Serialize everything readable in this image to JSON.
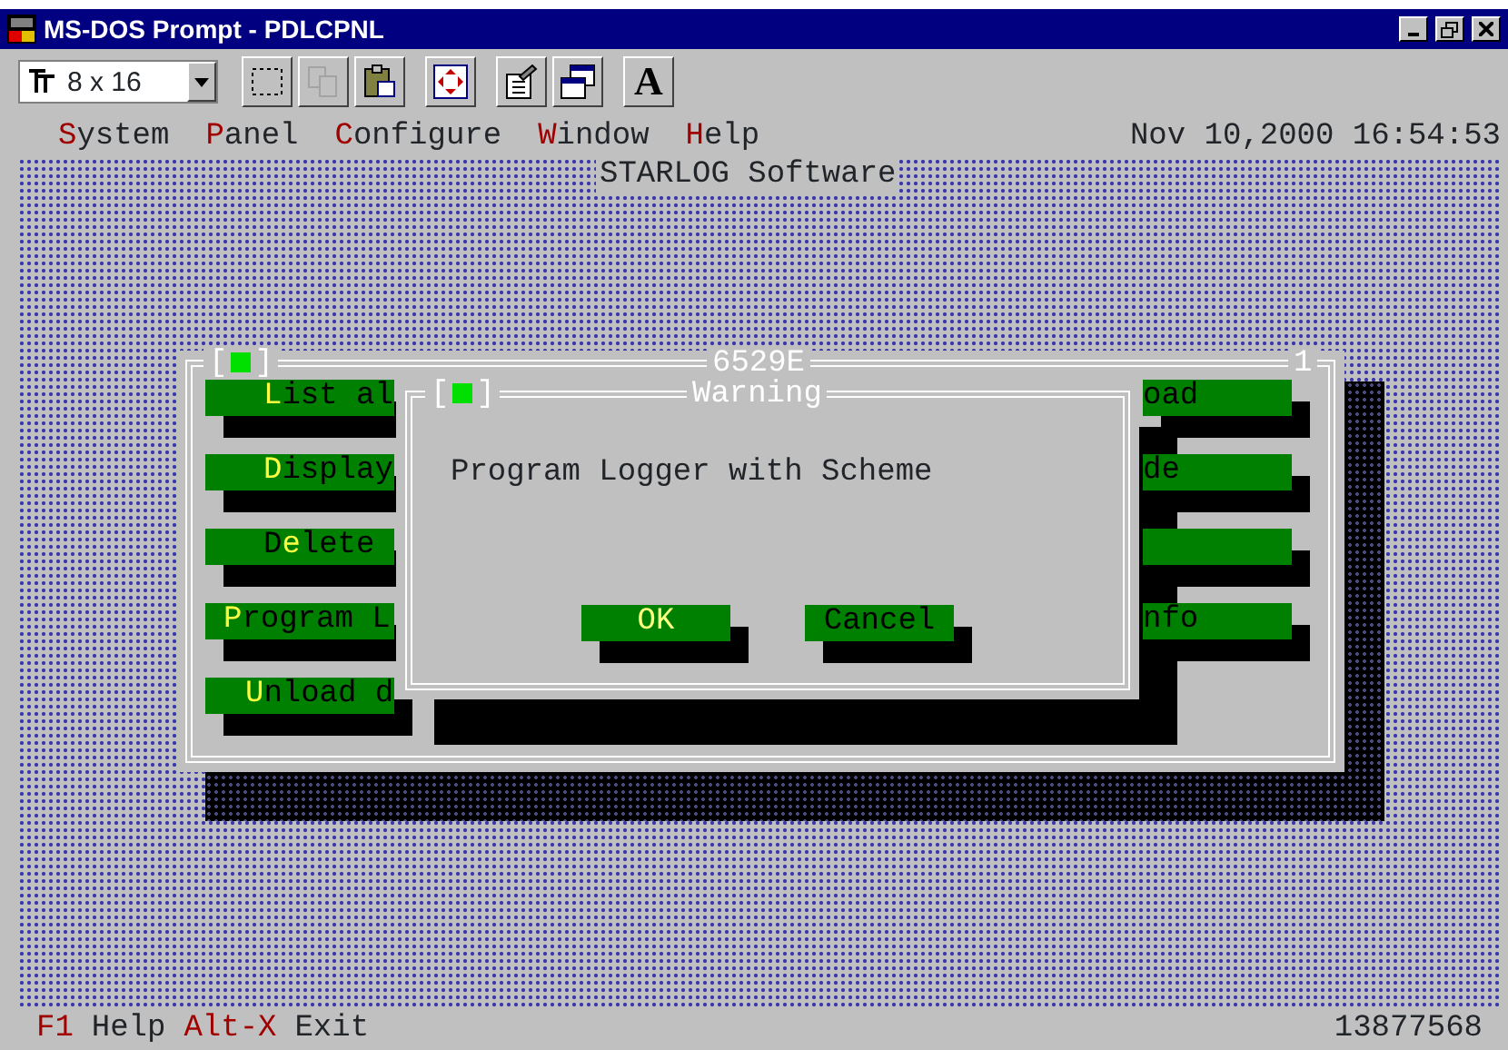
{
  "window": {
    "title": "MS-DOS Prompt - PDLCPNL"
  },
  "toolbar": {
    "font_size": "8 x 16",
    "buttons": [
      {
        "kind": "mark",
        "disabled": false
      },
      {
        "kind": "copy",
        "disabled": true
      },
      {
        "kind": "paste",
        "disabled": false
      },
      {
        "kind": "fullscreen",
        "disabled": false
      },
      {
        "kind": "properties",
        "disabled": false
      },
      {
        "kind": "background",
        "disabled": false
      },
      {
        "kind": "font",
        "label": "A",
        "disabled": false
      }
    ]
  },
  "menu": [
    {
      "segments": [
        {
          "text": "S",
          "hot": true
        },
        {
          "text": "ystem",
          "hot": false
        }
      ]
    },
    {
      "segments": [
        {
          "text": "P",
          "hot": true
        },
        {
          "text": "anel",
          "hot": false
        }
      ]
    },
    {
      "segments": [
        {
          "text": "C",
          "hot": true
        },
        {
          "text": "onfigure",
          "hot": false
        }
      ]
    },
    {
      "segments": [
        {
          "text": "W",
          "hot": true
        },
        {
          "text": "indow",
          "hot": false
        }
      ]
    },
    {
      "segments": [
        {
          "text": "H",
          "hot": true
        },
        {
          "text": "elp",
          "hot": false
        }
      ]
    }
  ],
  "clock": "Nov 10,2000 16:54:53",
  "app_title": "STARLOG Software",
  "panel": {
    "title": "6529E",
    "number": "1",
    "left_buttons": [
      {
        "segments": [
          {
            "text": "L",
            "hot": true
          },
          {
            "text": "ist al",
            "hot": false
          }
        ]
      },
      {
        "segments": [
          {
            "text": "D",
            "hot": true
          },
          {
            "text": "isplay",
            "hot": false
          }
        ]
      },
      {
        "segments": [
          {
            "text": "D",
            "hot": false
          },
          {
            "text": "e",
            "hot": true
          },
          {
            "text": "lete",
            "hot": false
          }
        ]
      },
      {
        "segments": [
          {
            "text": "P",
            "hot": true
          },
          {
            "text": "rogram L",
            "hot": false
          }
        ]
      },
      {
        "segments": [
          {
            "text": "U",
            "hot": true
          },
          {
            "text": "nload d",
            "hot": false
          }
        ]
      }
    ],
    "close_box": {
      "left": "[",
      "right": "]"
    },
    "right_buttons": [
      {
        "kind": "labeled",
        "label": "oad"
      },
      {
        "kind": "labeled",
        "label": "de"
      },
      {
        "kind": "blank"
      },
      {
        "kind": "labeled",
        "label": "nfo"
      }
    ]
  },
  "dialog": {
    "title": "Warning",
    "close_box": {
      "left": "[",
      "right": "]"
    },
    "message": "Program Logger with Scheme",
    "buttons": [
      {
        "label": "OK",
        "focused": true
      },
      {
        "label": "Cancel",
        "focused": false
      }
    ]
  },
  "status_bar": {
    "keys": [
      {
        "key": "F1",
        "label": "Help"
      },
      {
        "key": "Alt-X",
        "label": "Exit"
      }
    ],
    "counter": "13877568"
  }
}
